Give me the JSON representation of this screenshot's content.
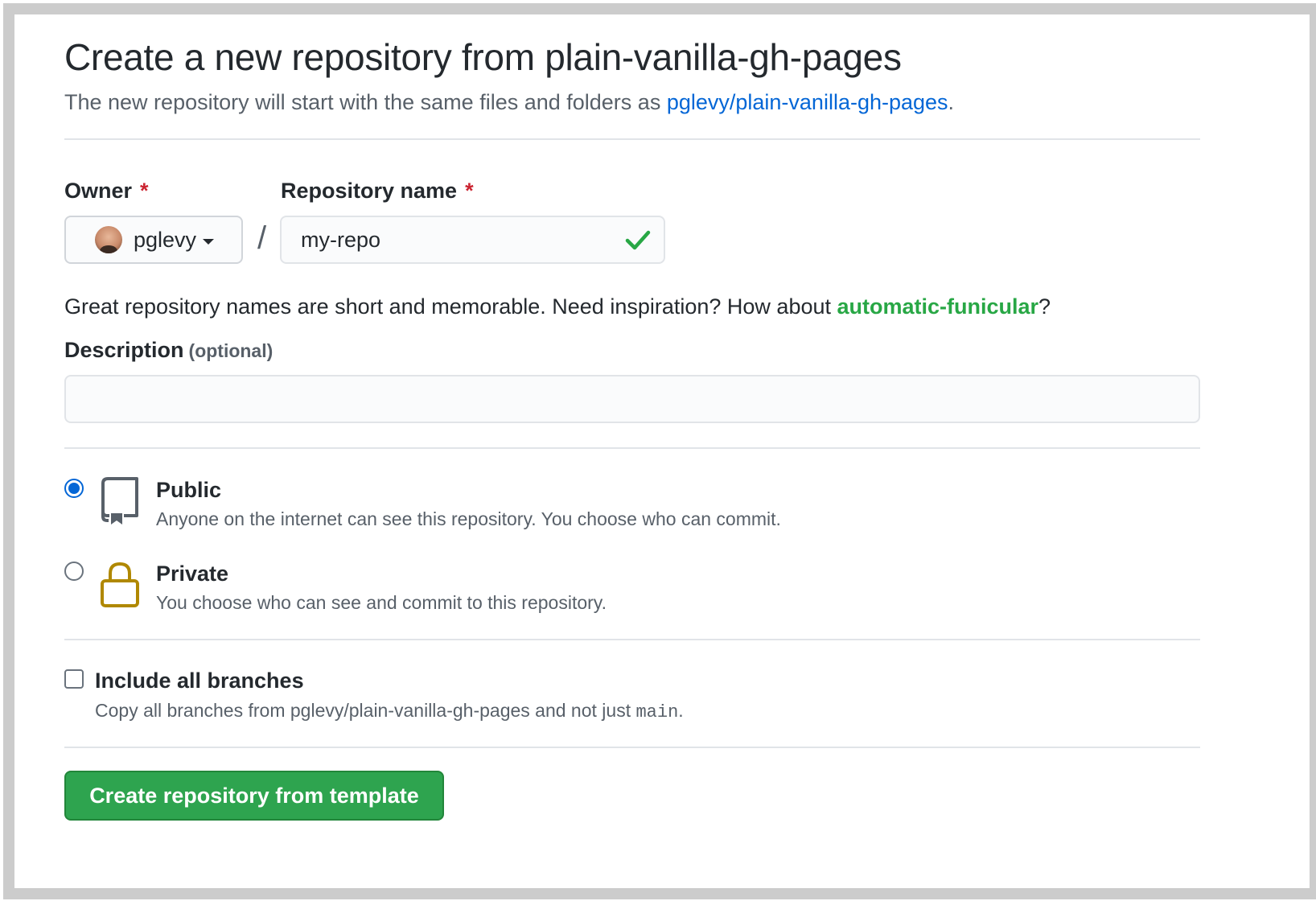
{
  "header": {
    "title": "Create a new repository from plain-vanilla-gh-pages",
    "subtitle_prefix": "The new repository will start with the same files and folders as ",
    "template_link": "pglevy/plain-vanilla-gh-pages",
    "subtitle_suffix": "."
  },
  "owner": {
    "label": "Owner",
    "required_mark": "*",
    "selected": "pglevy"
  },
  "repo_name": {
    "label": "Repository name",
    "required_mark": "*",
    "value": "my-repo",
    "separator": "/"
  },
  "hint": {
    "prefix": "Great repository names are short and memorable. Need inspiration? How about ",
    "suggestion": "automatic-funicular",
    "suffix": "?"
  },
  "description": {
    "label": "Description",
    "optional": "(optional)",
    "value": ""
  },
  "visibility": {
    "selected": "public",
    "public": {
      "title": "Public",
      "desc": "Anyone on the internet can see this repository. You choose who can commit."
    },
    "private": {
      "title": "Private",
      "desc": "You choose who can see and commit to this repository."
    }
  },
  "branches": {
    "label": "Include all branches",
    "desc_prefix": "Copy all branches from pglevy/plain-vanilla-gh-pages and not just ",
    "branch": "main",
    "desc_suffix": "."
  },
  "submit": {
    "label": "Create repository from template"
  },
  "colors": {
    "primary_button": "#2ea44f",
    "link": "#0366d6",
    "suggestion": "#28a745",
    "required": "#cb2431",
    "lock_icon": "#b08800"
  }
}
